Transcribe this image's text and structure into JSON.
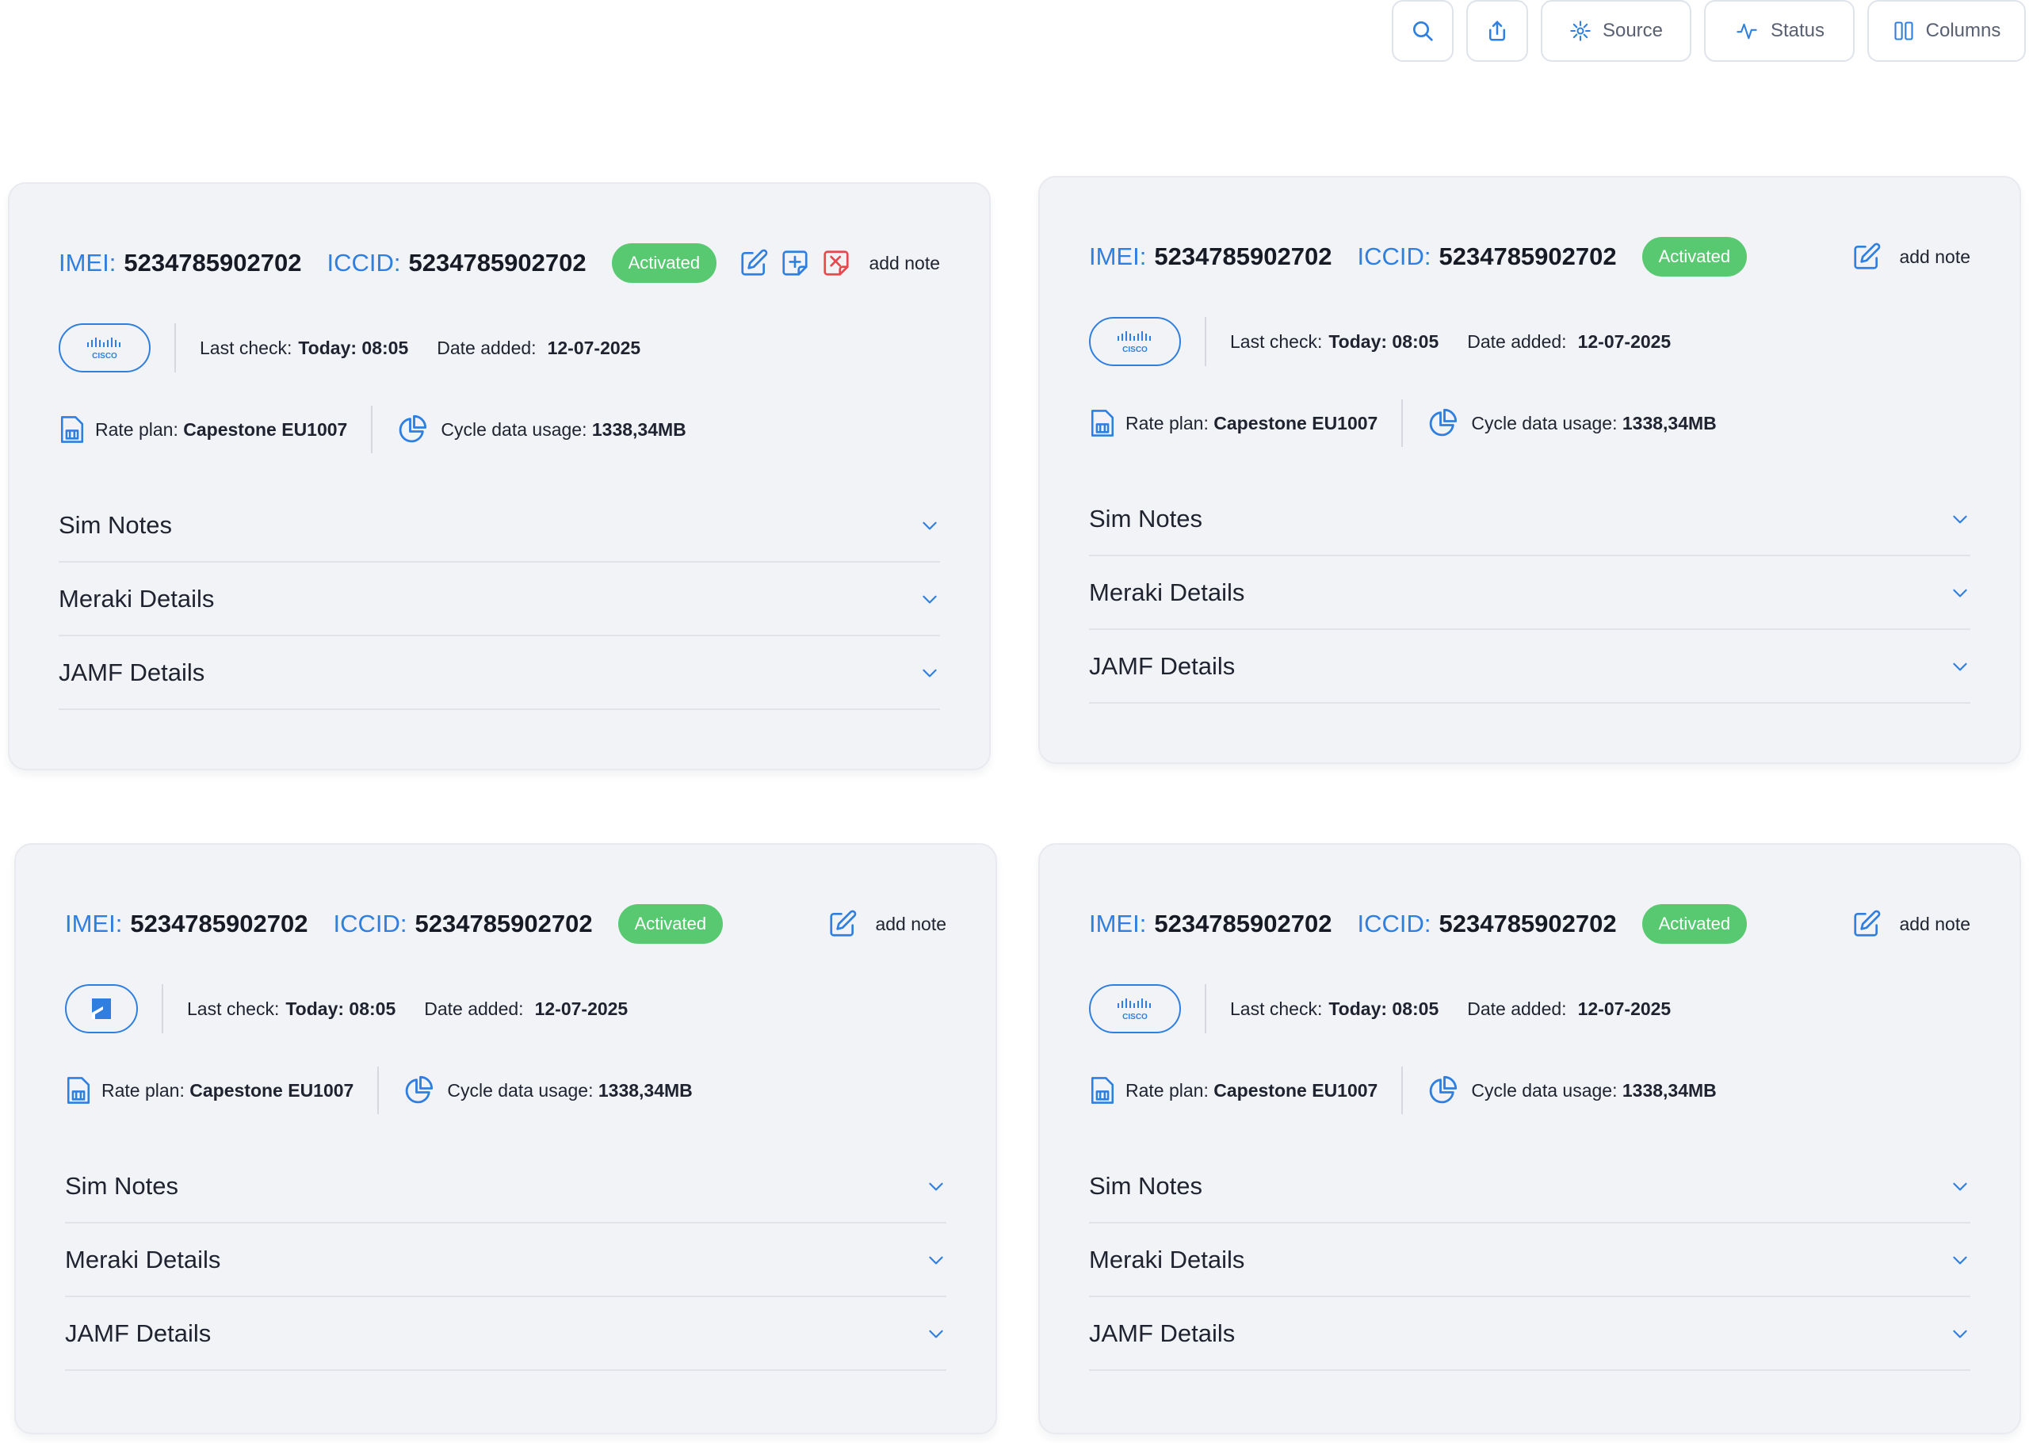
{
  "toolbar": {
    "search_icon": "search-icon",
    "share_icon": "share-icon",
    "source_label": "Source",
    "status_label": "Status",
    "columns_label": "Columns"
  },
  "colors": {
    "accent": "#2f7fe0",
    "badge": "#58c971",
    "danger": "#e5484d",
    "card_bg": "#f2f3f6"
  },
  "cards": [
    {
      "imei_label": "IMEI:",
      "imei": "5234785902702",
      "iccid_label": "ICCID:",
      "iccid": "5234785902702",
      "status": "Activated",
      "logo": "cisco",
      "last_check_label": "Last check:",
      "last_check": "Today: 08:05",
      "date_added_label": "Date added:",
      "date_added": "12-07-2025",
      "rate_plan_label": "Rate plan:",
      "rate_plan": "Capestone EU1007",
      "usage_label": "Cycle data usage:",
      "usage": "1338,34MB",
      "add_note": "add note",
      "sections": [
        "Sim Notes",
        "Meraki Details",
        "JAMF Details"
      ]
    },
    {
      "imei_label": "IMEI:",
      "imei": "5234785902702",
      "iccid_label": "ICCID:",
      "iccid": "5234785902702",
      "status": "Activated",
      "logo": "cisco",
      "last_check_label": "Last check:",
      "last_check": "Today: 08:05",
      "date_added_label": "Date added:",
      "date_added": "12-07-2025",
      "rate_plan_label": "Rate plan:",
      "rate_plan": "Capestone EU1007",
      "usage_label": "Cycle data usage:",
      "usage": "1338,34MB",
      "add_note": "add note",
      "sections": [
        "Sim Notes",
        "Meraki Details",
        "JAMF Details"
      ]
    },
    {
      "imei_label": "IMEI:",
      "imei": "5234785902702",
      "iccid_label": "ICCID:",
      "iccid": "5234785902702",
      "status": "Activated",
      "logo": "jamf",
      "last_check_label": "Last check:",
      "last_check": "Today: 08:05",
      "date_added_label": "Date added:",
      "date_added": "12-07-2025",
      "rate_plan_label": "Rate plan:",
      "rate_plan": "Capestone EU1007",
      "usage_label": "Cycle data usage:",
      "usage": "1338,34MB",
      "add_note": "add note",
      "sections": [
        "Sim Notes",
        "Meraki Details",
        "JAMF Details"
      ]
    },
    {
      "imei_label": "IMEI:",
      "imei": "5234785902702",
      "iccid_label": "ICCID:",
      "iccid": "5234785902702",
      "status": "Activated",
      "logo": "cisco",
      "last_check_label": "Last check:",
      "last_check": "Today: 08:05",
      "date_added_label": "Date added:",
      "date_added": "12-07-2025",
      "rate_plan_label": "Rate plan:",
      "rate_plan": "Capestone EU1007",
      "usage_label": "Cycle data usage:",
      "usage": "1338,34MB",
      "add_note": "add note",
      "sections": [
        "Sim Notes",
        "Meraki Details",
        "JAMF Details"
      ]
    }
  ]
}
